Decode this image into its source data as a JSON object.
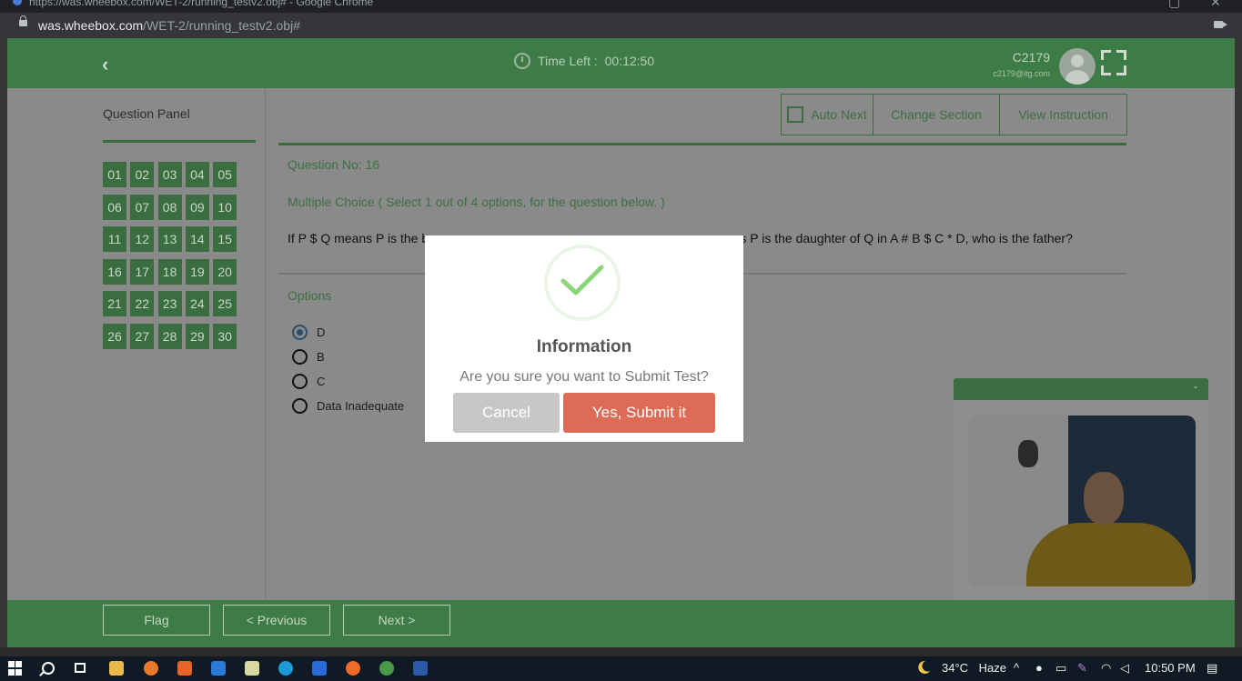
{
  "browser": {
    "title_partial": "https://was.wheebox.com/WET-2/running_testv2.obj# - Google Chrome",
    "url_domain": "was.wheebox.com",
    "url_path": "/WET-2/running_testv2.obj#"
  },
  "header": {
    "timer_label": "Time Left :",
    "timer_value": "00:12:50",
    "user_id": "C2179",
    "user_email": "c2179@itg.com"
  },
  "question_panel": {
    "title": "Question Panel",
    "numbers": [
      "01",
      "02",
      "03",
      "04",
      "05",
      "06",
      "07",
      "08",
      "09",
      "10",
      "11",
      "12",
      "13",
      "14",
      "15",
      "16",
      "17",
      "18",
      "19",
      "20",
      "21",
      "22",
      "23",
      "24",
      "25",
      "26",
      "27",
      "28",
      "29",
      "30"
    ]
  },
  "toolbar": {
    "auto_next": "Auto Next",
    "change_section": "Change Section",
    "view_instruction": "View Instruction"
  },
  "question": {
    "number_label": "Question No: 16",
    "type_label": "Multiple Choice ( Select 1 out of 4 options, for the question below. )",
    "text_start": "If P $ Q means P is the b",
    "text_end": "eans P is the daughter of Q in A # B $ C * D, who is the father?",
    "options_label": "Options",
    "options": [
      {
        "label": "D",
        "selected": true
      },
      {
        "label": "B",
        "selected": false
      },
      {
        "label": "C",
        "selected": false
      },
      {
        "label": "Data Inadequate",
        "selected": false
      }
    ]
  },
  "webcam": {
    "minimize": "-"
  },
  "footer": {
    "flag": "Flag",
    "previous": "< Previous",
    "next": "Next >"
  },
  "modal": {
    "title": "Information",
    "message": "Are you sure you want to Submit Test?",
    "cancel": "Cancel",
    "confirm": "Yes, Submit it"
  },
  "taskbar": {
    "temperature": "34°C",
    "weather": "Haze",
    "time": "10:50 PM"
  },
  "colors": {
    "brand_green": "#3d7c46",
    "confirm_red": "#dd6b55",
    "cancel_grey": "#c7c7c7"
  }
}
